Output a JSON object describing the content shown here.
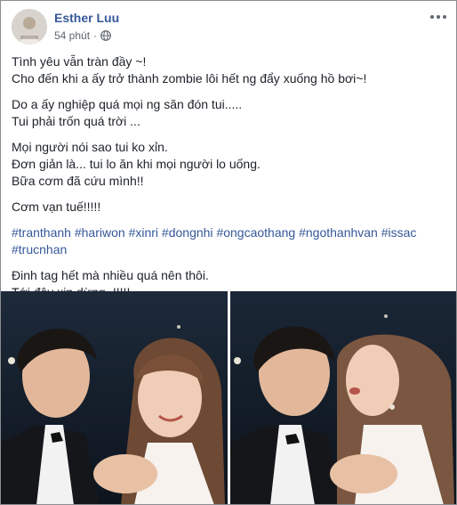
{
  "post": {
    "author": "Esther Luu",
    "time": "54 phút",
    "separator": "·",
    "privacy_icon": "globe-icon",
    "menu_icon": "more-horizontal-icon",
    "paragraphs": [
      [
        "Tình yêu vẫn tràn đầy ~!",
        "Cho đến khi a ấy trở thành zombie lôi hết ng đẩy xuống hồ bơi~!"
      ],
      [
        "Do a ấy nghiệp quá mọi ng săn đón tui.....",
        "Tui phải trốn quá trời ..."
      ],
      [
        "Mọi người nói sao tui ko xỉn.",
        "Đơn giản là... tui lo ăn khi mọi người lo uống.",
        "Bữa cơm đã cứu mình!!"
      ],
      [
        "Cơm vạn tuế!!!!!"
      ]
    ],
    "hashtags": [
      "#tranthanh",
      "#hariwon",
      "#xinri",
      "#dongnhi",
      "#ongcaothang",
      "#ngothanhvan",
      "#issac",
      "#trucnhan"
    ],
    "closing": [
      "Đinh tag hết mà nhiều quá nên thôi.",
      "Tới đây xin dừng~!!!!!"
    ],
    "photos": [
      {
        "name": "photo-couple-smiling"
      },
      {
        "name": "photo-couple-kiss"
      }
    ]
  },
  "colors": {
    "link": "#365899",
    "text": "#1d2129",
    "meta": "#616770"
  }
}
